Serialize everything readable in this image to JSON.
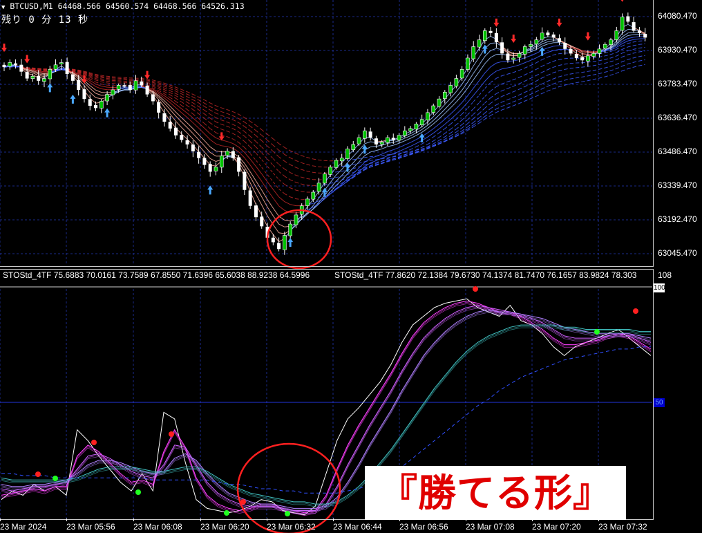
{
  "chart_header": {
    "symbol_line": "BTCUSD,M1  64468.566 64560.574 64468.566 64526.313",
    "remaining": "残り 0 分 13 秒"
  },
  "price_axis": [
    "64080.470",
    "63930.470",
    "63783.470",
    "63636.470",
    "63486.470",
    "63339.470",
    "63192.470",
    "63045.470"
  ],
  "indicator": {
    "label_1": "STOStd_4TF 75.6883 70.0161 73.7589 67.8550 71.6396 65.6038 88.9238 64.5996",
    "label_2": "STOStd_4TF 77.8620 72.1384 79.6730 74.1374 81.7470 76.1657 83.9824 78.303",
    "max_label": "108",
    "level_100": "100",
    "level_50": "50"
  },
  "time_axis": [
    "23 Mar 2024",
    "23 Mar 05:56",
    "23 Mar 06:08",
    "23 Mar 06:20",
    "23 Mar 06:32",
    "23 Mar 06:44",
    "23 Mar 06:56",
    "23 Mar 07:08",
    "23 Mar 07:20",
    "23 Mar 07:32"
  ],
  "banner": "『勝てる形』",
  "colors": {
    "background": "#000000",
    "bull_candle": "#00c000",
    "bear_candle": "#ffffff",
    "grid": "#1a2a8a",
    "highlight_circle": "#ff2020",
    "banner_text": "#e00000"
  },
  "chart_data": [
    {
      "type": "candlestick",
      "title": "BTCUSD,M1",
      "ylim": [
        62980,
        64120
      ],
      "ytick_labels": [
        "64080.470",
        "63930.470",
        "63783.470",
        "63636.470",
        "63486.470",
        "63339.470",
        "63192.470",
        "63045.470"
      ],
      "close_series": [
        63840,
        63860,
        63850,
        63820,
        63790,
        63800,
        63780,
        63790,
        63830,
        63850,
        63860,
        63810,
        63780,
        63740,
        63700,
        63670,
        63660,
        63690,
        63720,
        63740,
        63760,
        63760,
        63740,
        63780,
        63760,
        63720,
        63690,
        63640,
        63600,
        63570,
        63540,
        63520,
        63500,
        63470,
        63440,
        63410,
        63380,
        63400,
        63450,
        63470,
        63440,
        63380,
        63300,
        63230,
        63180,
        63140,
        63090,
        63070,
        63040,
        63100,
        63150,
        63190,
        63230,
        63260,
        63290,
        63330,
        63370,
        63400,
        63430,
        63440,
        63480,
        63500,
        63530,
        63560,
        63530,
        63500,
        63510,
        63530,
        63520,
        63540,
        63560,
        63570,
        63590,
        63610,
        63640,
        63670,
        63700,
        63730,
        63760,
        63790,
        63830,
        63880,
        63930,
        63960,
        64000,
        63990,
        63950,
        63900,
        63870,
        63880,
        63900,
        63930,
        63940,
        63960,
        63990,
        63980,
        63970,
        63950,
        63920,
        63900,
        63880,
        63870,
        63890,
        63900,
        63920,
        63940,
        63960,
        64000,
        64060,
        64040,
        64000,
        63990,
        63970
      ],
      "annotation": "red circle around the low near 23 Mar 06:32"
    },
    {
      "type": "line",
      "title": "STOStd_4TF",
      "ylim": [
        0,
        108
      ],
      "ytick_labels": [
        "100",
        "50"
      ],
      "series": [
        {
          "values": [
            8,
            12,
            10,
            15,
            12,
            14,
            10,
            40,
            35,
            28,
            22,
            16,
            12,
            20,
            12,
            48,
            45,
            25,
            8,
            4,
            3,
            2,
            3,
            5,
            8,
            7,
            3,
            2,
            1,
            5,
            20,
            35,
            45,
            50,
            56,
            62,
            70,
            80,
            88,
            92,
            96,
            98,
            99,
            100,
            96,
            94,
            92,
            97,
            90,
            88,
            84,
            78,
            74,
            78,
            80,
            82,
            84,
            86,
            82,
            78,
            74
          ]
        },
        {
          "values": [
            10,
            11,
            12,
            13,
            12,
            14,
            14,
            28,
            33,
            30,
            25,
            20,
            16,
            17,
            15,
            30,
            40,
            32,
            18,
            10,
            6,
            4,
            3,
            4,
            6,
            6,
            4,
            3,
            2,
            3,
            10,
            22,
            33,
            42,
            50,
            58,
            66,
            75,
            83,
            89,
            93,
            96,
            98,
            99,
            98,
            96,
            94,
            94,
            92,
            89,
            86,
            82,
            79,
            79,
            80,
            81,
            83,
            84,
            83,
            80,
            77
          ]
        },
        {
          "values": [
            13,
            12,
            13,
            14,
            14,
            15,
            16,
            22,
            28,
            29,
            27,
            24,
            21,
            19,
            18,
            24,
            33,
            32,
            24,
            16,
            11,
            8,
            6,
            5,
            5,
            5,
            4,
            3,
            3,
            3,
            6,
            14,
            24,
            33,
            42,
            50,
            58,
            67,
            75,
            82,
            87,
            91,
            94,
            96,
            97,
            96,
            95,
            94,
            93,
            91,
            89,
            86,
            83,
            82,
            82,
            82,
            83,
            84,
            84,
            82,
            80
          ]
        },
        {
          "values": [
            15,
            14,
            14,
            15,
            15,
            16,
            17,
            20,
            24,
            26,
            26,
            25,
            23,
            21,
            20,
            21,
            27,
            29,
            26,
            20,
            15,
            11,
            9,
            7,
            6,
            6,
            5,
            4,
            4,
            4,
            5,
            9,
            16,
            24,
            33,
            41,
            49,
            58,
            66,
            74,
            80,
            85,
            89,
            92,
            94,
            95,
            94,
            94,
            93,
            92,
            91,
            89,
            87,
            86,
            85,
            84,
            84,
            84,
            84,
            83,
            82
          ]
        },
        {
          "values": [
            18,
            17,
            17,
            17,
            17,
            17,
            17,
            18,
            20,
            22,
            23,
            23,
            23,
            22,
            21,
            21,
            22,
            23,
            23,
            21,
            18,
            15,
            13,
            11,
            10,
            9,
            8,
            7,
            7,
            6,
            6,
            7,
            10,
            14,
            19,
            25,
            31,
            38,
            45,
            52,
            59,
            65,
            71,
            76,
            80,
            83,
            85,
            87,
            88,
            88,
            88,
            88,
            87,
            87,
            86,
            86,
            86,
            86,
            86,
            85,
            85
          ]
        },
        {
          "values": [
            20,
            20,
            19,
            19,
            19,
            18,
            18,
            18,
            18,
            18,
            18,
            18,
            18,
            18,
            17,
            17,
            17,
            17,
            17,
            17,
            16,
            15,
            15,
            14,
            13,
            13,
            12,
            12,
            11,
            11,
            11,
            11,
            12,
            13,
            15,
            17,
            20,
            23,
            27,
            31,
            35,
            39,
            43,
            47,
            51,
            54,
            58,
            61,
            64,
            66,
            68,
            70,
            72,
            73,
            74,
            75,
            76,
            77,
            77,
            78,
            78
          ]
        }
      ]
    }
  ]
}
